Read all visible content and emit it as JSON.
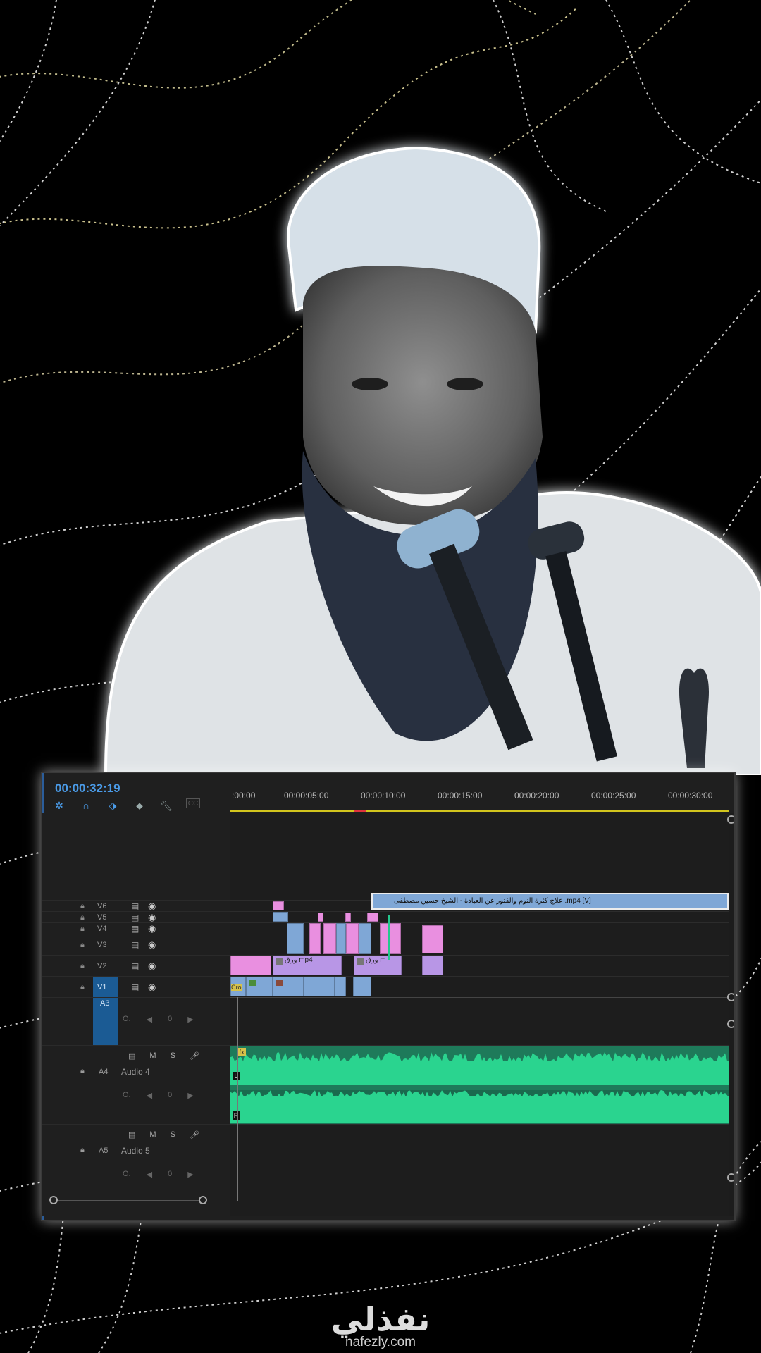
{
  "timeline": {
    "timecode": "00:00:32:19",
    "ruler_labels": [
      ":00:00",
      "00:00:05:00",
      "00:00:10:00",
      "00:00:15:00",
      "00:00:20:00",
      "00:00:25:00",
      "00:00:30:00"
    ],
    "video_tracks": [
      {
        "name": "V6"
      },
      {
        "name": "V5"
      },
      {
        "name": "V4"
      },
      {
        "name": "V3"
      },
      {
        "name": "V2"
      },
      {
        "name": "V1"
      }
    ],
    "a3_track_name": "A3",
    "audio_tracks": [
      {
        "name": "A4",
        "label": "Audio 4",
        "m": "M",
        "s": "S"
      },
      {
        "name": "A5",
        "label": "Audio 5",
        "m": "M",
        "s": "S"
      }
    ],
    "volume_value": "0",
    "clips": {
      "v2_clip_a": "ورق mp4",
      "v2_clip_b": "ورق m",
      "v1_main": "علاج كثرة النوم والفتور عن العبادة  - الشيخ حسين مصطفى .mp4 [V]",
      "v1_start": "Cro"
    },
    "audio_badges": {
      "fx": "fx",
      "left": "L",
      "right": "R"
    },
    "accent_color": "#4a9ae6"
  },
  "logo": {
    "arabic": "نفذلي",
    "url": "nafezly.com"
  }
}
